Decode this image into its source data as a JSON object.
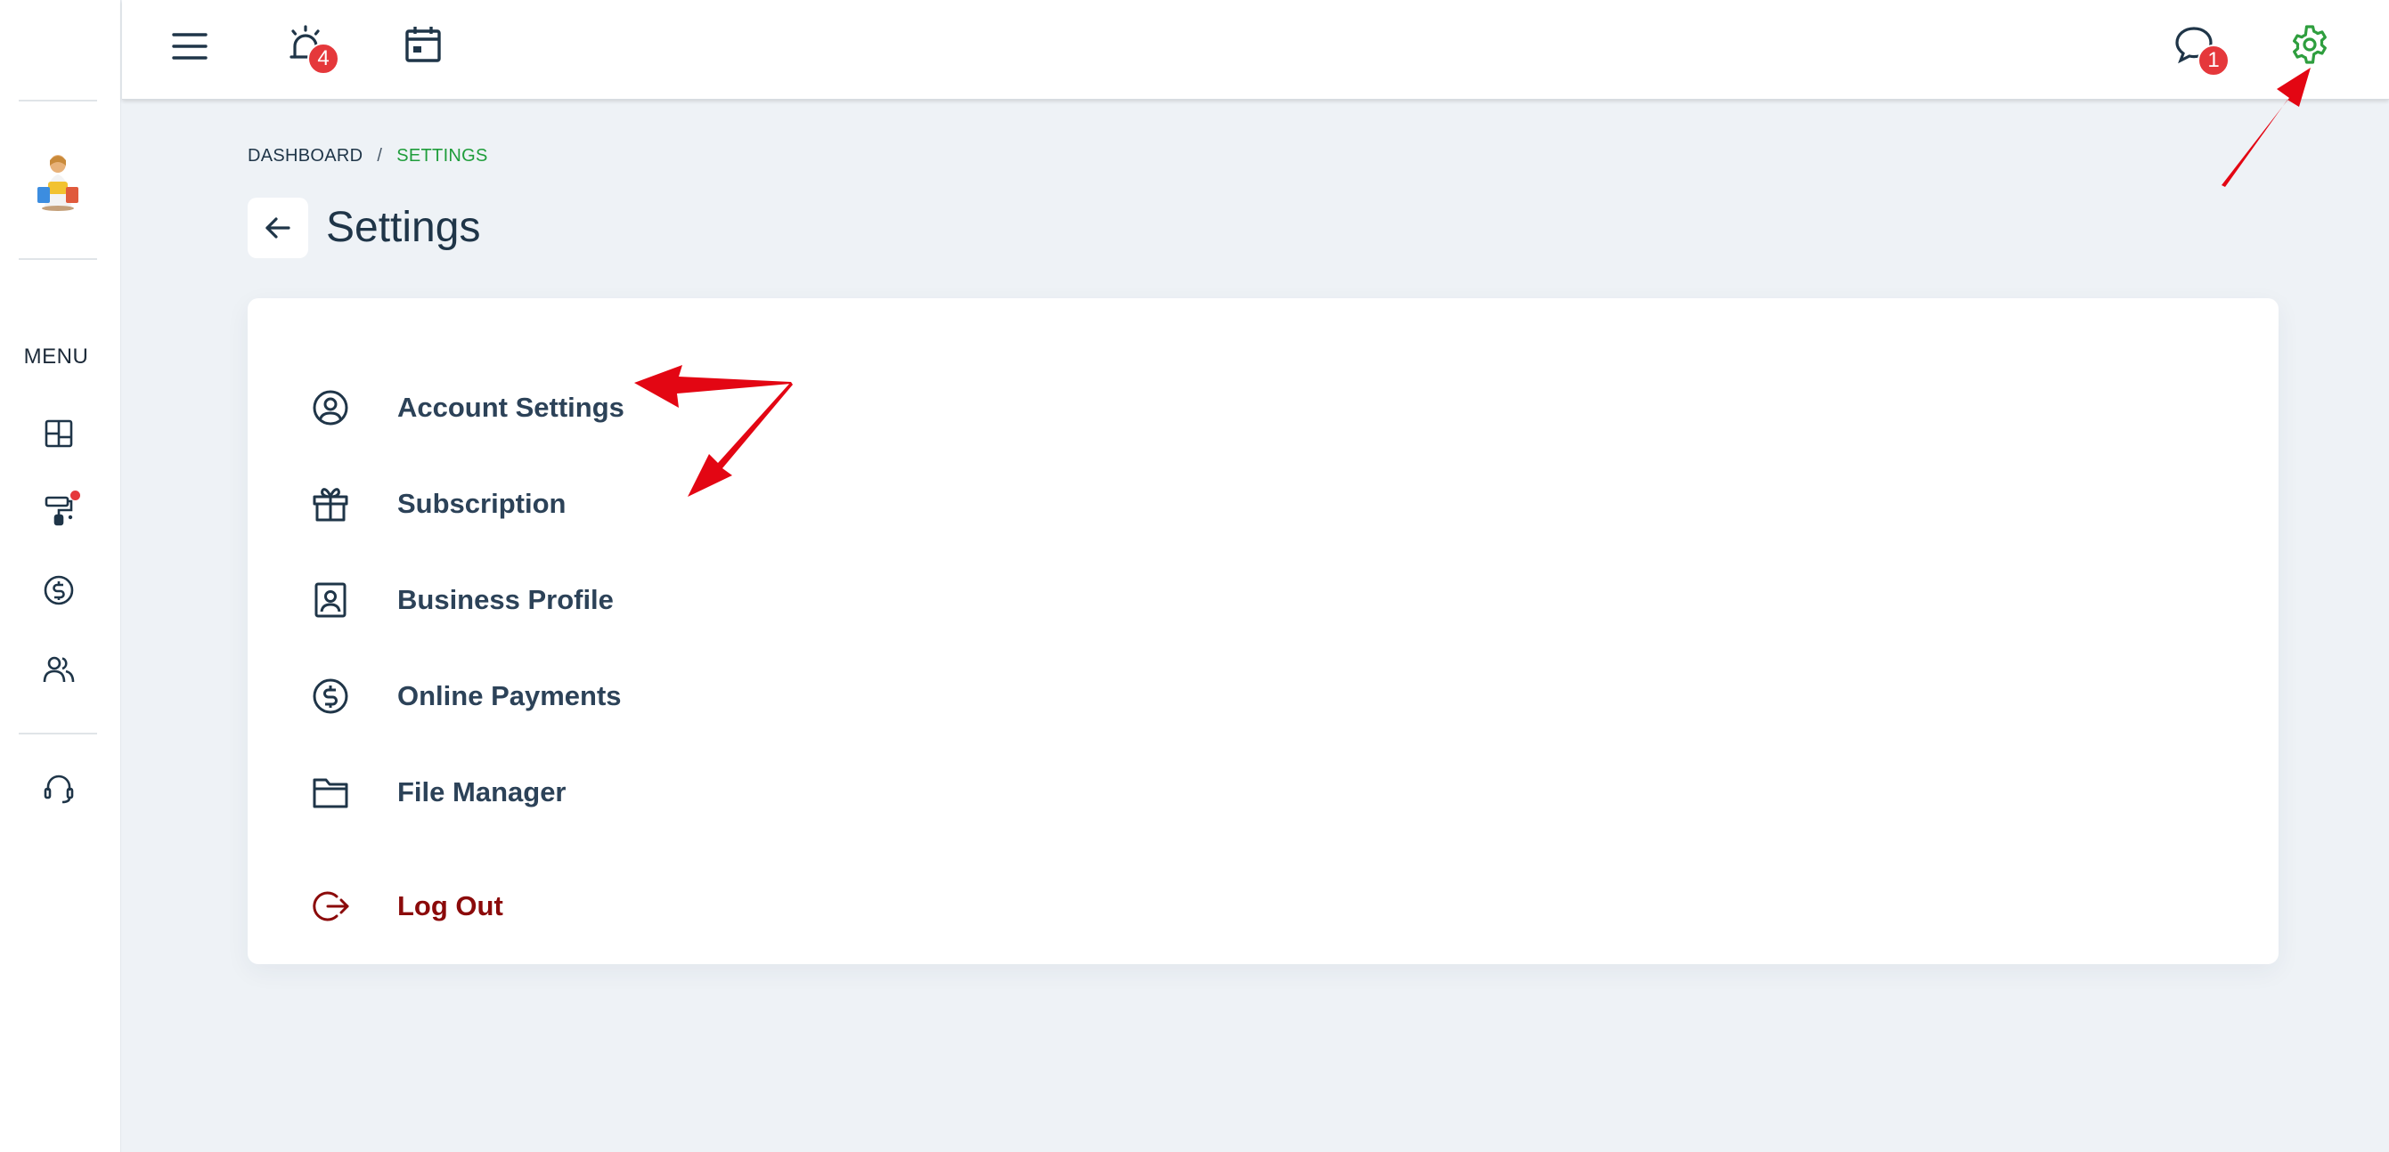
{
  "sidebar": {
    "menu_label": "MENU",
    "icons": [
      "dashboard-grid-icon",
      "paint-roller-icon",
      "dollar-circle-icon",
      "users-icon",
      "headset-icon"
    ],
    "notification_dot_color": "#e5383b"
  },
  "topbar": {
    "alerts_badge": "4",
    "messages_badge": "1",
    "settings_icon_color": "#2e9e3e",
    "badge_color": "#e5383b"
  },
  "breadcrumb": {
    "root": "DASHBOARD",
    "separator": "/",
    "current": "SETTINGS"
  },
  "page": {
    "title": "Settings"
  },
  "settings_menu": [
    {
      "label": "Account Settings",
      "icon": "user-circle-icon"
    },
    {
      "label": "Subscription",
      "icon": "gift-icon"
    },
    {
      "label": "Business Profile",
      "icon": "profile-card-icon"
    },
    {
      "label": "Online Payments",
      "icon": "dollar-circle-icon"
    },
    {
      "label": "File Manager",
      "icon": "folder-icon"
    },
    {
      "label": "Log Out",
      "icon": "logout-icon"
    }
  ],
  "colors": {
    "accent_green": "#1f9d3b",
    "text_dark": "#1f3548",
    "logout_red": "#8b0a0a",
    "annotation_red": "#e30613"
  }
}
